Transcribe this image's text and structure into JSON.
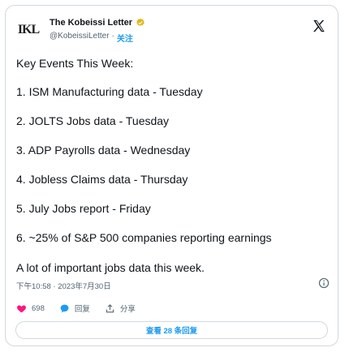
{
  "author": {
    "avatar_text": "IKL",
    "display_name": "The Kobeissi Letter",
    "handle": "@KobeissiLetter",
    "separator": "·",
    "follow_label": "关注"
  },
  "post": {
    "intro": "Key Events This Week:",
    "items": [
      "1. ISM Manufacturing data - Tuesday",
      "2. JOLTS Jobs data - Tuesday",
      "3. ADP Payrolls data - Wednesday",
      "4. Jobless Claims data - Thursday",
      "5. July Jobs report - Friday",
      "6. ~25% of S&P 500 companies reporting earnings"
    ],
    "closing": "A lot of important jobs data this week.",
    "timestamp": "下午10:58 · 2023年7月30日"
  },
  "actions": {
    "like_count": "698",
    "reply_label": "回复",
    "share_label": "分享"
  },
  "replies_button_label": "查看 28 条回复",
  "colors": {
    "accent": "#1d9bf0",
    "like": "#f91880",
    "muted": "#536471",
    "border": "#cfd9de"
  },
  "icons": [
    "verified-badge-icon",
    "x-logo-icon",
    "info-icon",
    "heart-icon",
    "reply-bubble-icon",
    "share-icon"
  ]
}
